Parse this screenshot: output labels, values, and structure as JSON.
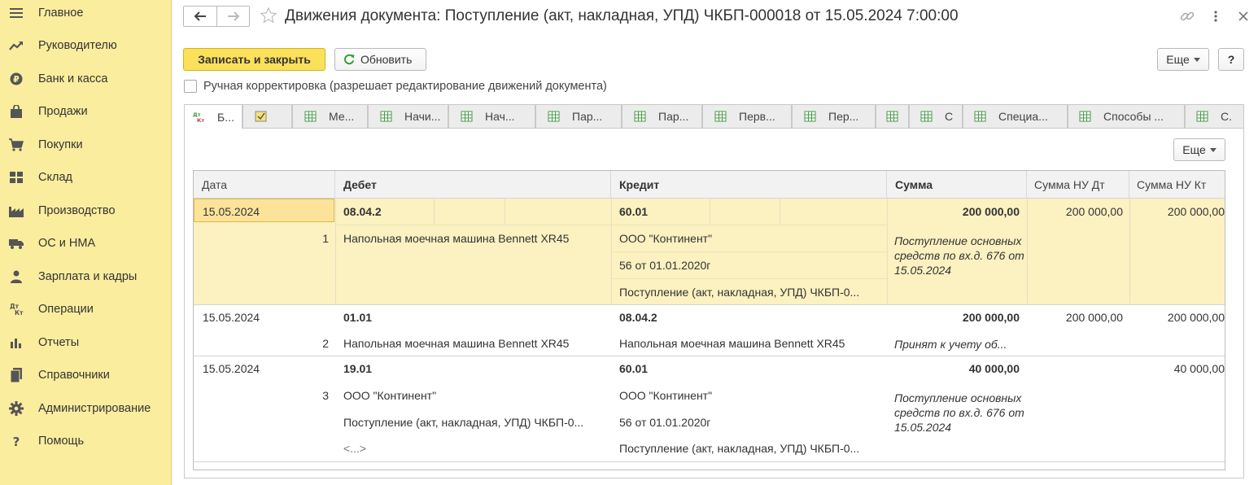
{
  "sidebar": {
    "items": [
      {
        "label": "Главное",
        "icon": "menu-icon"
      },
      {
        "label": "Руководителю",
        "icon": "trend-icon"
      },
      {
        "label": "Банк и касса",
        "icon": "coin-icon"
      },
      {
        "label": "Продажи",
        "icon": "bag-icon"
      },
      {
        "label": "Покупки",
        "icon": "cart-icon"
      },
      {
        "label": "Склад",
        "icon": "warehouse-icon"
      },
      {
        "label": "Производство",
        "icon": "factory-icon"
      },
      {
        "label": "ОС и НМА",
        "icon": "truck-icon"
      },
      {
        "label": "Зарплата и кадры",
        "icon": "person-icon"
      },
      {
        "label": "Операции",
        "icon": "dt-kt-icon"
      },
      {
        "label": "Отчеты",
        "icon": "bar-chart-icon"
      },
      {
        "label": "Справочники",
        "icon": "books-icon"
      },
      {
        "label": "Администрирование",
        "icon": "gear-icon"
      },
      {
        "label": "Помощь",
        "icon": "question-icon"
      }
    ]
  },
  "window": {
    "title": "Движения документа: Поступление (акт, накладная, УПД) ЧКБП-000018 от 15.05.2024 7:00:00"
  },
  "toolbar": {
    "save_close": "Записать и закрыть",
    "refresh": "Обновить",
    "more": "Еще",
    "help": "?"
  },
  "manual_correction": {
    "label": "Ручная корректировка (разрешает редактирование движений документа)",
    "checked": false
  },
  "tabs": [
    {
      "label": "Б..."
    },
    {
      "label": ""
    },
    {
      "label": "Ме..."
    },
    {
      "label": "Начи..."
    },
    {
      "label": "Нач..."
    },
    {
      "label": "Пар..."
    },
    {
      "label": "Пар..."
    },
    {
      "label": "Перв..."
    },
    {
      "label": "Пер..."
    },
    {
      "label": ""
    },
    {
      "label": "С"
    },
    {
      "label": "Специа..."
    },
    {
      "label": "Способы ..."
    },
    {
      "label": "С."
    }
  ],
  "panel": {
    "more": "Еще"
  },
  "table": {
    "headers": {
      "date": "Дата",
      "debit": "Дебет",
      "credit": "Кредит",
      "sum": "Сумма",
      "sum_nu_dt": "Сумма НУ Дт",
      "sum_nu_kt": "Сумма НУ Кт"
    },
    "rows": [
      {
        "date": "15.05.2024",
        "num": "1",
        "debit_account": "08.04.2",
        "debit_sub": [
          "Напольная моечная машина Bennett XR45"
        ],
        "credit_account": "60.01",
        "credit_sub": [
          "ООО \"Континент\"",
          "56 от 01.01.2020г",
          "Поступление (акт, накладная, УПД) ЧКБП-0..."
        ],
        "sum": "200 000,00",
        "content": "Поступление основных средств по вх.д. 676 от 15.05.2024",
        "sum_nu_dt": "200 000,00",
        "sum_nu_kt": "200 000,00"
      },
      {
        "date": "15.05.2024",
        "num": "2",
        "debit_account": "01.01",
        "debit_sub": [
          "Напольная моечная машина Bennett XR45"
        ],
        "credit_account": "08.04.2",
        "credit_sub": [
          "Напольная моечная машина Bennett XR45"
        ],
        "sum": "200 000,00",
        "content": "Принят к учету об...",
        "sum_nu_dt": "200 000,00",
        "sum_nu_kt": "200 000,00"
      },
      {
        "date": "15.05.2024",
        "num": "3",
        "debit_account": "19.01",
        "debit_sub": [
          "ООО \"Континент\"",
          "Поступление (акт, накладная, УПД) ЧКБП-0...",
          "<...>"
        ],
        "credit_account": "60.01",
        "credit_sub": [
          "ООО \"Континент\"",
          "56 от 01.01.2020г",
          "Поступление (акт, накладная, УПД) ЧКБП-0..."
        ],
        "sum": "40 000,00",
        "content": "Поступление основных средств по вх.д. 676 от 15.05.2024",
        "sum_nu_dt": "",
        "sum_nu_kt": "40 000,00"
      }
    ]
  }
}
